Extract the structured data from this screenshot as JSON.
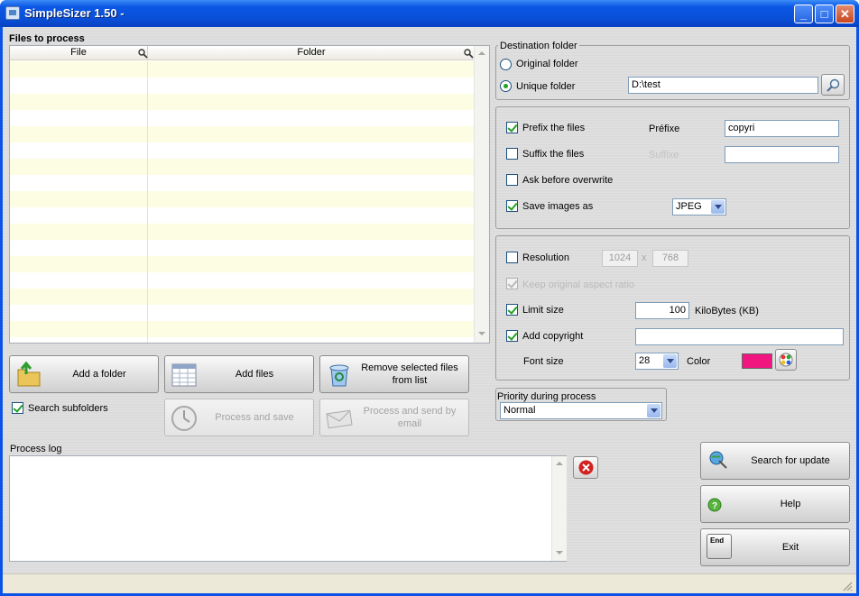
{
  "window": {
    "title": "SimpleSizer 1.50 -",
    "minimize": "_",
    "maximize": "□",
    "close": "✕"
  },
  "files": {
    "label": "Files to process",
    "columns": [
      {
        "name": "File"
      },
      {
        "name": "Folder"
      }
    ]
  },
  "buttons": {
    "add_folder": "Add a folder",
    "add_files": "Add files",
    "remove_selected": "Remove selected files from list",
    "process_save": "Process and save",
    "process_email": "Process and send by email",
    "search_update": "Search for update",
    "help": "Help",
    "exit": "Exit",
    "end_key": "End"
  },
  "search_subfolders": {
    "label": "Search subfolders",
    "checked": true
  },
  "destination": {
    "legend": "Destination folder",
    "original": "Original folder",
    "unique": "Unique folder",
    "path": "D:\\test"
  },
  "naming": {
    "prefix_label": "Prefix the files",
    "prefix_field_label": "Préfixe",
    "prefix_value": "copyri",
    "suffix_label": "Suffix the files",
    "suffix_field_label": "Suffixe",
    "ask_overwrite": "Ask before overwrite",
    "save_as": "Save images as",
    "format": "JPEG"
  },
  "resize": {
    "resolution": "Resolution",
    "width": "1024",
    "x": "x",
    "height": "768",
    "keep_ratio": "Keep original aspect ratio",
    "limit_size": "Limit size",
    "limit_value": "100",
    "limit_unit": "KiloBytes (KB)",
    "add_copyright": "Add copyright",
    "copyright_value": "",
    "font_size_label": "Font size",
    "font_size": "28",
    "color_label": "Color",
    "color_value": "#f0157f"
  },
  "priority": {
    "legend": "Priority during process",
    "value": "Normal"
  },
  "log": {
    "label": "Process log"
  }
}
